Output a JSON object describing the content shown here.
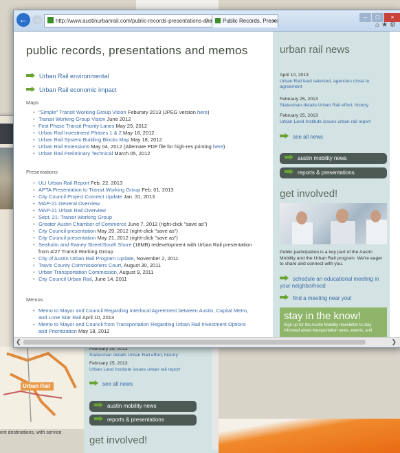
{
  "browser": {
    "url": "http://www.austinurbanrail.com/public-records-presentations-and-mer",
    "tab_title": "Public Records, Presentatio...",
    "back_icon": "back-arrow-icon"
  },
  "main": {
    "title": "public records, presentations and memos",
    "top_links": [
      "Urban Rail environmental",
      "Urban Rail economic impact"
    ],
    "maps_heading": "Maps",
    "maps": [
      {
        "pre": "\"Simple\" Transit Working Group Vision",
        "rest": " Feburary 2013 (JPEG version ",
        "link2": "here",
        "end": ")"
      },
      {
        "pre": "Transit Working Group Vision",
        "rest": " June 2012",
        "link2": "",
        "end": ""
      },
      {
        "pre": "First Phase Transit Priority Lanes",
        "rest": " May 29, 2012",
        "link2": "",
        "end": ""
      },
      {
        "pre": "Urban Rail Investment Phases 1 & 2",
        "rest": " May 18, 2012",
        "link2": "",
        "end": ""
      },
      {
        "pre": "Urban Rail System Building Blocks Map",
        "rest": " May 18, 2012",
        "link2": "",
        "end": ""
      },
      {
        "pre": "Urban Rail Extensions",
        "rest": " May 04, 2012 (Alternate PDF file for high-res printing ",
        "link2": "here",
        "end": ")"
      },
      {
        "pre": "Urban Rail Preliminary Technical",
        "rest": " March 05, 2012",
        "link2": "",
        "end": ""
      }
    ],
    "presentations_heading": "Presentations",
    "presentations": [
      {
        "pre": "ULI Urban Rail Report",
        "rest": " Feb. 22, 2013"
      },
      {
        "pre": "APTA Presentation to Transit Working Group",
        "rest": " Feb. 01, 2013"
      },
      {
        "pre": "City Council Project Connect Update",
        "rest": " Jan. 31, 2013"
      },
      {
        "pre": "MAP-21 General Overview",
        "rest": ""
      },
      {
        "pre": "MAP-21 Urban Rail Overview",
        "rest": ""
      },
      {
        "pre": "Sept. 21: Transit Working Group",
        "rest": ""
      },
      {
        "pre": "Greater Austin Chamber of Commerce",
        "rest": " June 7, 2012 (right-click \"save as\")"
      },
      {
        "pre": "City Council presentation",
        "rest": " May 29, 2012 (right-click \"save as\")"
      },
      {
        "pre": "City Council presentation",
        "rest": " May 21, 2012 (right-click \"save as\")"
      },
      {
        "pre": "Seaholm and Rainey Street/South Shore",
        "rest": " (18MB) redevelopment with Urban Rail presentation from 4/27 Transit Working Group"
      },
      {
        "pre": "City of Austin Urban Rail Program Update",
        "rest": ", November 2, 2011"
      },
      {
        "pre": "Travis County Commissioners Court",
        "rest": ", August 30, 2011"
      },
      {
        "pre": "Urban Transportation Commission",
        "rest": ", August 9, 2011"
      },
      {
        "pre": "City Council Urban Rail",
        "rest": ", June 14, 2011"
      }
    ],
    "memos_heading": "Memos",
    "memos": [
      {
        "pre": "Memo to Mayor and Council Regarding Interlocal Agreement between Austin, Capital Metro, and Lone Star Rail",
        "rest": " April 10, 2013"
      },
      {
        "pre": "Memo to Mayor and Council from Transportation Regarding Urban Rail Investment Options and Prioritization",
        "rest": " May 18, 2012"
      }
    ]
  },
  "sidebar": {
    "news_title": "urban rail news",
    "news": [
      {
        "date": "April 10, 2013",
        "title": "Urban Rail lead selected, agencies close to agreement"
      },
      {
        "date": "February 25, 2013",
        "title": "Statesman details Urban Rail effort, history"
      },
      {
        "date": "February 25, 2013",
        "title": "Urban Land Institute issues urban rail report"
      }
    ],
    "see_all": "see all news",
    "pills": [
      "austin mobility news",
      "reports & presentations"
    ],
    "involved_title": "get involved!",
    "involved_text": "Public participation is a key part of the Austin Mobility and the Urban Rail program. We're eager to share and connect with you.",
    "involved_links": [
      "schedule an educational meeting in your neighborhood",
      "find a meeting near you!"
    ],
    "stay_title": "stay in the know!",
    "stay_text": "Sign up for the Austin Mobility newsletter to stay informed about transportation news, events, and"
  },
  "background_window": {
    "news": [
      {
        "date": "February 25, 2013",
        "title": "Statesman details Urban Rail effort, history"
      },
      {
        "date": "February 25, 2013",
        "title": "Urban Land Institute issues urban rail report"
      }
    ],
    "see_all": "see all news",
    "pills": [
      "austin mobility news",
      "reports & presentations"
    ],
    "involved_title": "get involved!",
    "map_label": "Urban Rail",
    "caption": "ent destinations, with service"
  },
  "colors": {
    "accent_green": "#69a332",
    "link_blue": "#3a6aa8",
    "pill_dark": "#4d5a54"
  }
}
